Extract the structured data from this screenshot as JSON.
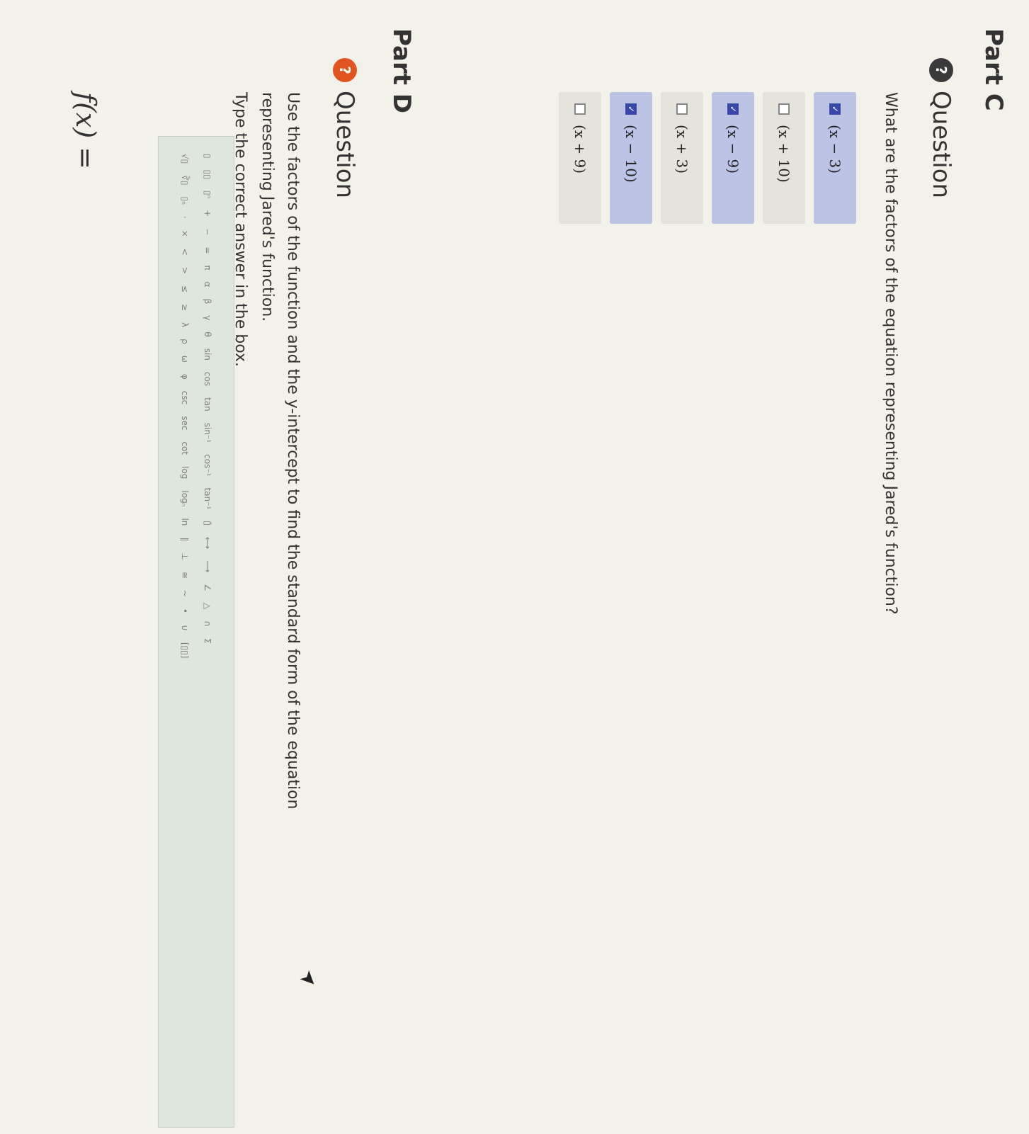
{
  "partC": {
    "title": "Part C",
    "question_label": "Question",
    "question_badge": "?",
    "prompt": "What are the factors of the equation representing Jared's function?",
    "options": [
      {
        "label": "(x − 3)",
        "checked": true
      },
      {
        "label": "(x + 10)",
        "checked": false
      },
      {
        "label": "(x − 9)",
        "checked": true
      },
      {
        "label": "(x + 3)",
        "checked": false
      },
      {
        "label": "(x − 10)",
        "checked": true
      },
      {
        "label": "(x + 9)",
        "checked": false
      }
    ]
  },
  "partD": {
    "title": "Part D",
    "question_label": "Question",
    "question_badge": "?",
    "prompt": "Use the factors of the function and the y-intercept to find the standard form of the equation representing Jared's function.",
    "instruction": "Type the correct answer in the box.",
    "answer_label": "f(x) =",
    "answer_value": ""
  },
  "toolbar": {
    "row1": [
      "▯",
      "▯▯",
      "▯ⁿ",
      "+",
      "−",
      "=",
      "π",
      "α",
      "β",
      "γ",
      "θ",
      "sin",
      "cos",
      "tan",
      "sin⁻¹",
      "cos⁻¹",
      "tan⁻¹",
      "▯̄",
      "⟷",
      "⟶",
      "∠",
      "△",
      "∩",
      "Σ"
    ],
    "row2": [
      "√▯",
      "∛▯",
      "▯ₙ",
      "·",
      "×",
      "<",
      ">",
      "≤",
      "≥",
      "λ",
      "ρ",
      "ω",
      "φ",
      "csc",
      "sec",
      "cot",
      "log",
      "logₙ",
      "ln",
      "∥",
      "⊥",
      "≅",
      "~",
      "•",
      "∪",
      "[▯▯]"
    ]
  },
  "colors": {
    "badge_partC": "#3a3a3a",
    "badge_partD": "#e0541f",
    "checked_bg": "#bcc4e6",
    "checkbox_checked": "#3949ab"
  }
}
